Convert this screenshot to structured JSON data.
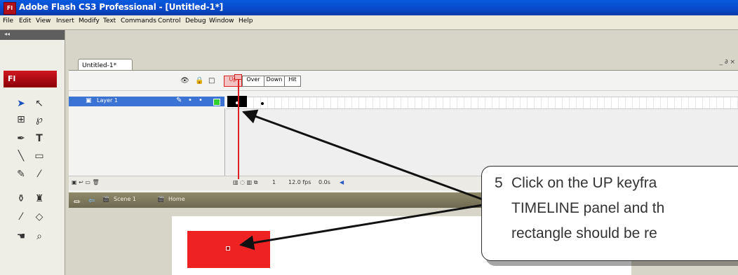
{
  "window": {
    "title": "Adobe Flash CS3 Professional - [Untitled-1*]",
    "app_icon": "Fl",
    "controls": "_ ∂ ×"
  },
  "menu": [
    "File",
    "Edit",
    "View",
    "Insert",
    "Modify",
    "Text",
    "Commands",
    "Control",
    "Debug",
    "Window",
    "Help"
  ],
  "tools": {
    "grip": "◂◂",
    "logo": "Fl"
  },
  "document": {
    "tab": "Untitled-1*"
  },
  "timeline": {
    "states": [
      "Up",
      "Over",
      "Down",
      "Hit"
    ],
    "layer_name": "Layer 1",
    "frame_number": "1",
    "fps": "12.0 fps",
    "time": "0.0s"
  },
  "editbar": {
    "scene": "Scene 1",
    "symbol": "Home"
  },
  "callout": {
    "number": "5",
    "lines": [
      "Click on the UP keyfra",
      "TIMELINE panel and th",
      "rectangle should be re"
    ]
  },
  "colors": {
    "title_bar": "#0848c8",
    "highlight": "#d02020",
    "rectangle": "#ee2222",
    "layer_selected": "#3a73d4"
  }
}
